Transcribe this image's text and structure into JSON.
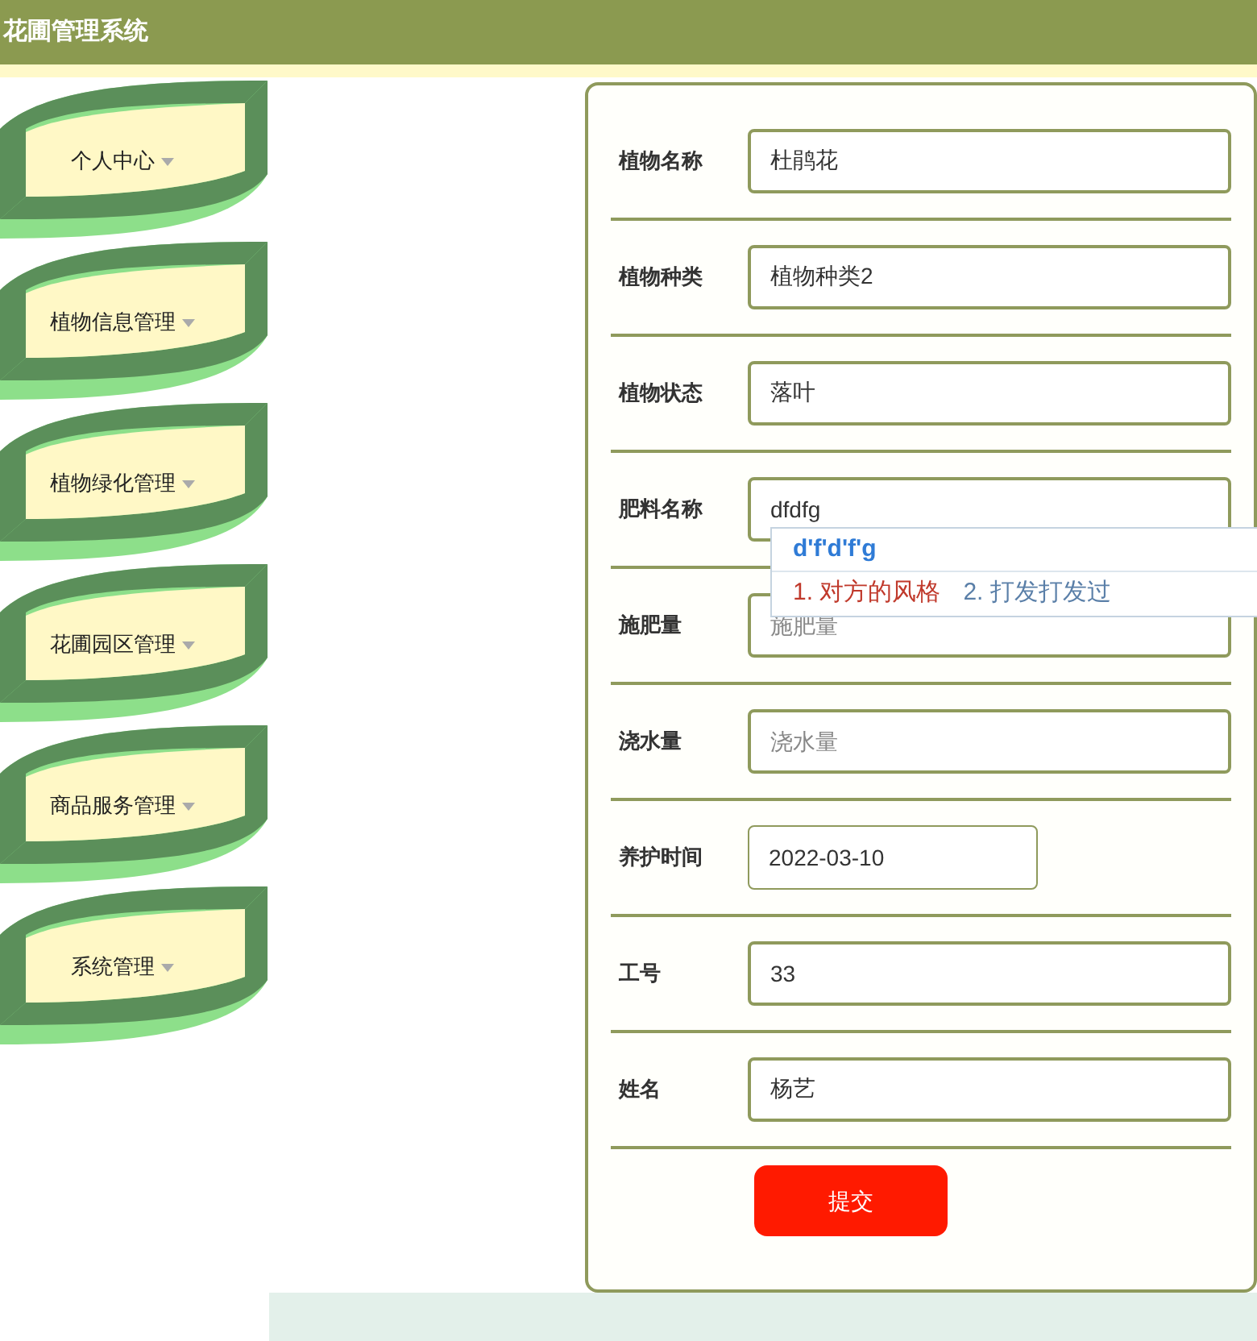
{
  "header": {
    "title": "花圃管理系统"
  },
  "sidebar": {
    "items": [
      {
        "label": "个人中心"
      },
      {
        "label": "植物信息管理"
      },
      {
        "label": "植物绿化管理"
      },
      {
        "label": "花圃园区管理"
      },
      {
        "label": "商品服务管理"
      },
      {
        "label": "系统管理"
      }
    ]
  },
  "form": {
    "fields": [
      {
        "label": "植物名称",
        "value": "杜鹃花",
        "kind": "text"
      },
      {
        "label": "植物种类",
        "value": "植物种类2",
        "kind": "text"
      },
      {
        "label": "植物状态",
        "value": "落叶",
        "kind": "text"
      },
      {
        "label": "肥料名称",
        "value": "dfdfg",
        "kind": "text"
      },
      {
        "label": "施肥量",
        "placeholder": "施肥量",
        "kind": "text"
      },
      {
        "label": "浇水量",
        "placeholder": "浇水量",
        "kind": "text"
      },
      {
        "label": "养护时间",
        "value": "2022-03-10",
        "kind": "date"
      },
      {
        "label": "工号",
        "value": "33",
        "kind": "text"
      },
      {
        "label": "姓名",
        "value": "杨艺",
        "kind": "text"
      }
    ],
    "submit": "提交"
  },
  "ime": {
    "composition": "d'f'd'f'g",
    "candidates": [
      {
        "label": "1. 对方的风格",
        "selected": true
      },
      {
        "label": "2. 打发打发过",
        "selected": false
      }
    ]
  }
}
